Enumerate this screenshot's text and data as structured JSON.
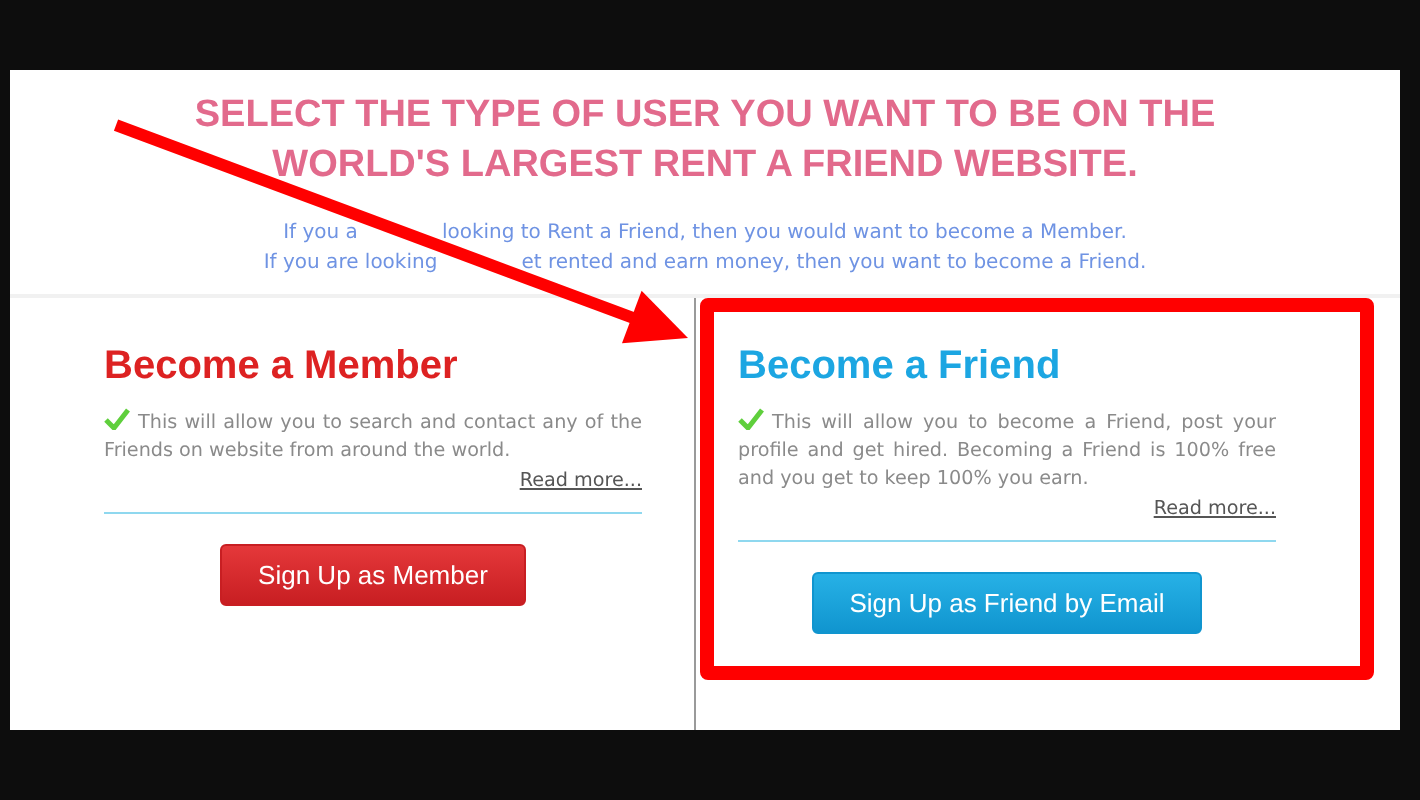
{
  "title_lines": [
    "SELECT THE TYPE OF USER YOU WANT TO BE ON THE",
    "WORLD'S LARGEST RENT A FRIEND WEBSITE."
  ],
  "intro": [
    [
      "If you a",
      "looking to Rent a Friend, then you would want to become a Member."
    ],
    [
      "If you are looking",
      "et rented and earn money, then you want to become a Friend."
    ]
  ],
  "options": [
    {
      "kind": "member",
      "heading": "Become a Member",
      "text": "This will allow you to search and contact any of the Friends on website from around the world.",
      "link": "Read more...",
      "button": "Sign Up as Member",
      "highlighted": false
    },
    {
      "kind": "friend",
      "heading": "Become a Friend",
      "text": "This will allow you to become a Friend, post your profile and get hired. Becoming a Friend is 100% free and you get to keep 100% you earn.",
      "link": "Read more...",
      "button": "Sign Up as Friend by Email",
      "highlighted": true
    }
  ]
}
